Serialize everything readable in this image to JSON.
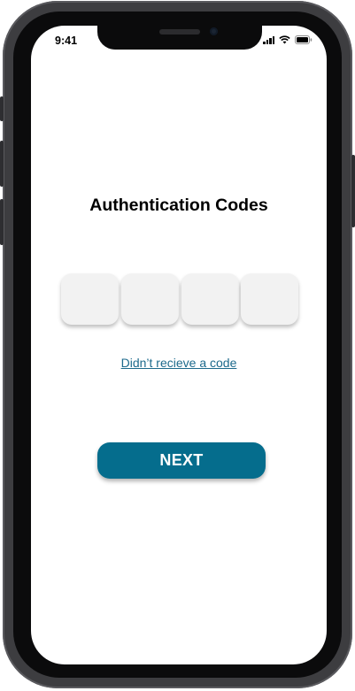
{
  "status_bar": {
    "time": "9:41"
  },
  "screen": {
    "title": "Authentication Codes",
    "code_boxes": [
      "",
      "",
      "",
      ""
    ],
    "resend_link": "Didn’t recieve a code",
    "next_button": "NEXT"
  },
  "colors": {
    "accent": "#056d8d",
    "link": "#1d6a8c",
    "code_box_bg": "#f2f2f2"
  }
}
